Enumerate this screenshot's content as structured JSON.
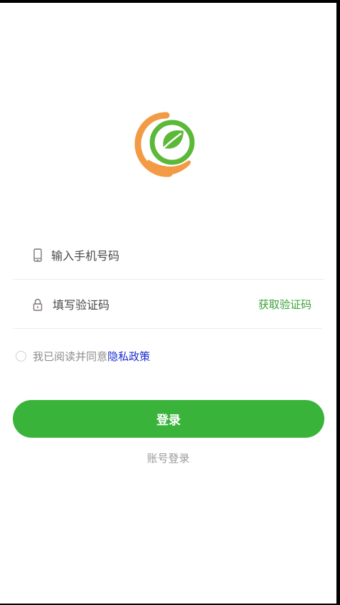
{
  "login": {
    "phone_placeholder": "输入手机号码",
    "code_placeholder": "填写验证码",
    "get_code_label": "获取验证码",
    "agree_text": "我已阅读并同意",
    "privacy_link": "隐私政策",
    "login_button": "登录",
    "account_login": "账号登录"
  },
  "icons": {
    "logo": "leaf-in-hand-logo",
    "phone": "phone-icon",
    "lock": "lock-icon"
  },
  "colors": {
    "accent_green": "#3ab33a",
    "link_blue": "#1a2fd0",
    "logo_orange": "#f29a45",
    "logo_green": "#5cb838"
  }
}
